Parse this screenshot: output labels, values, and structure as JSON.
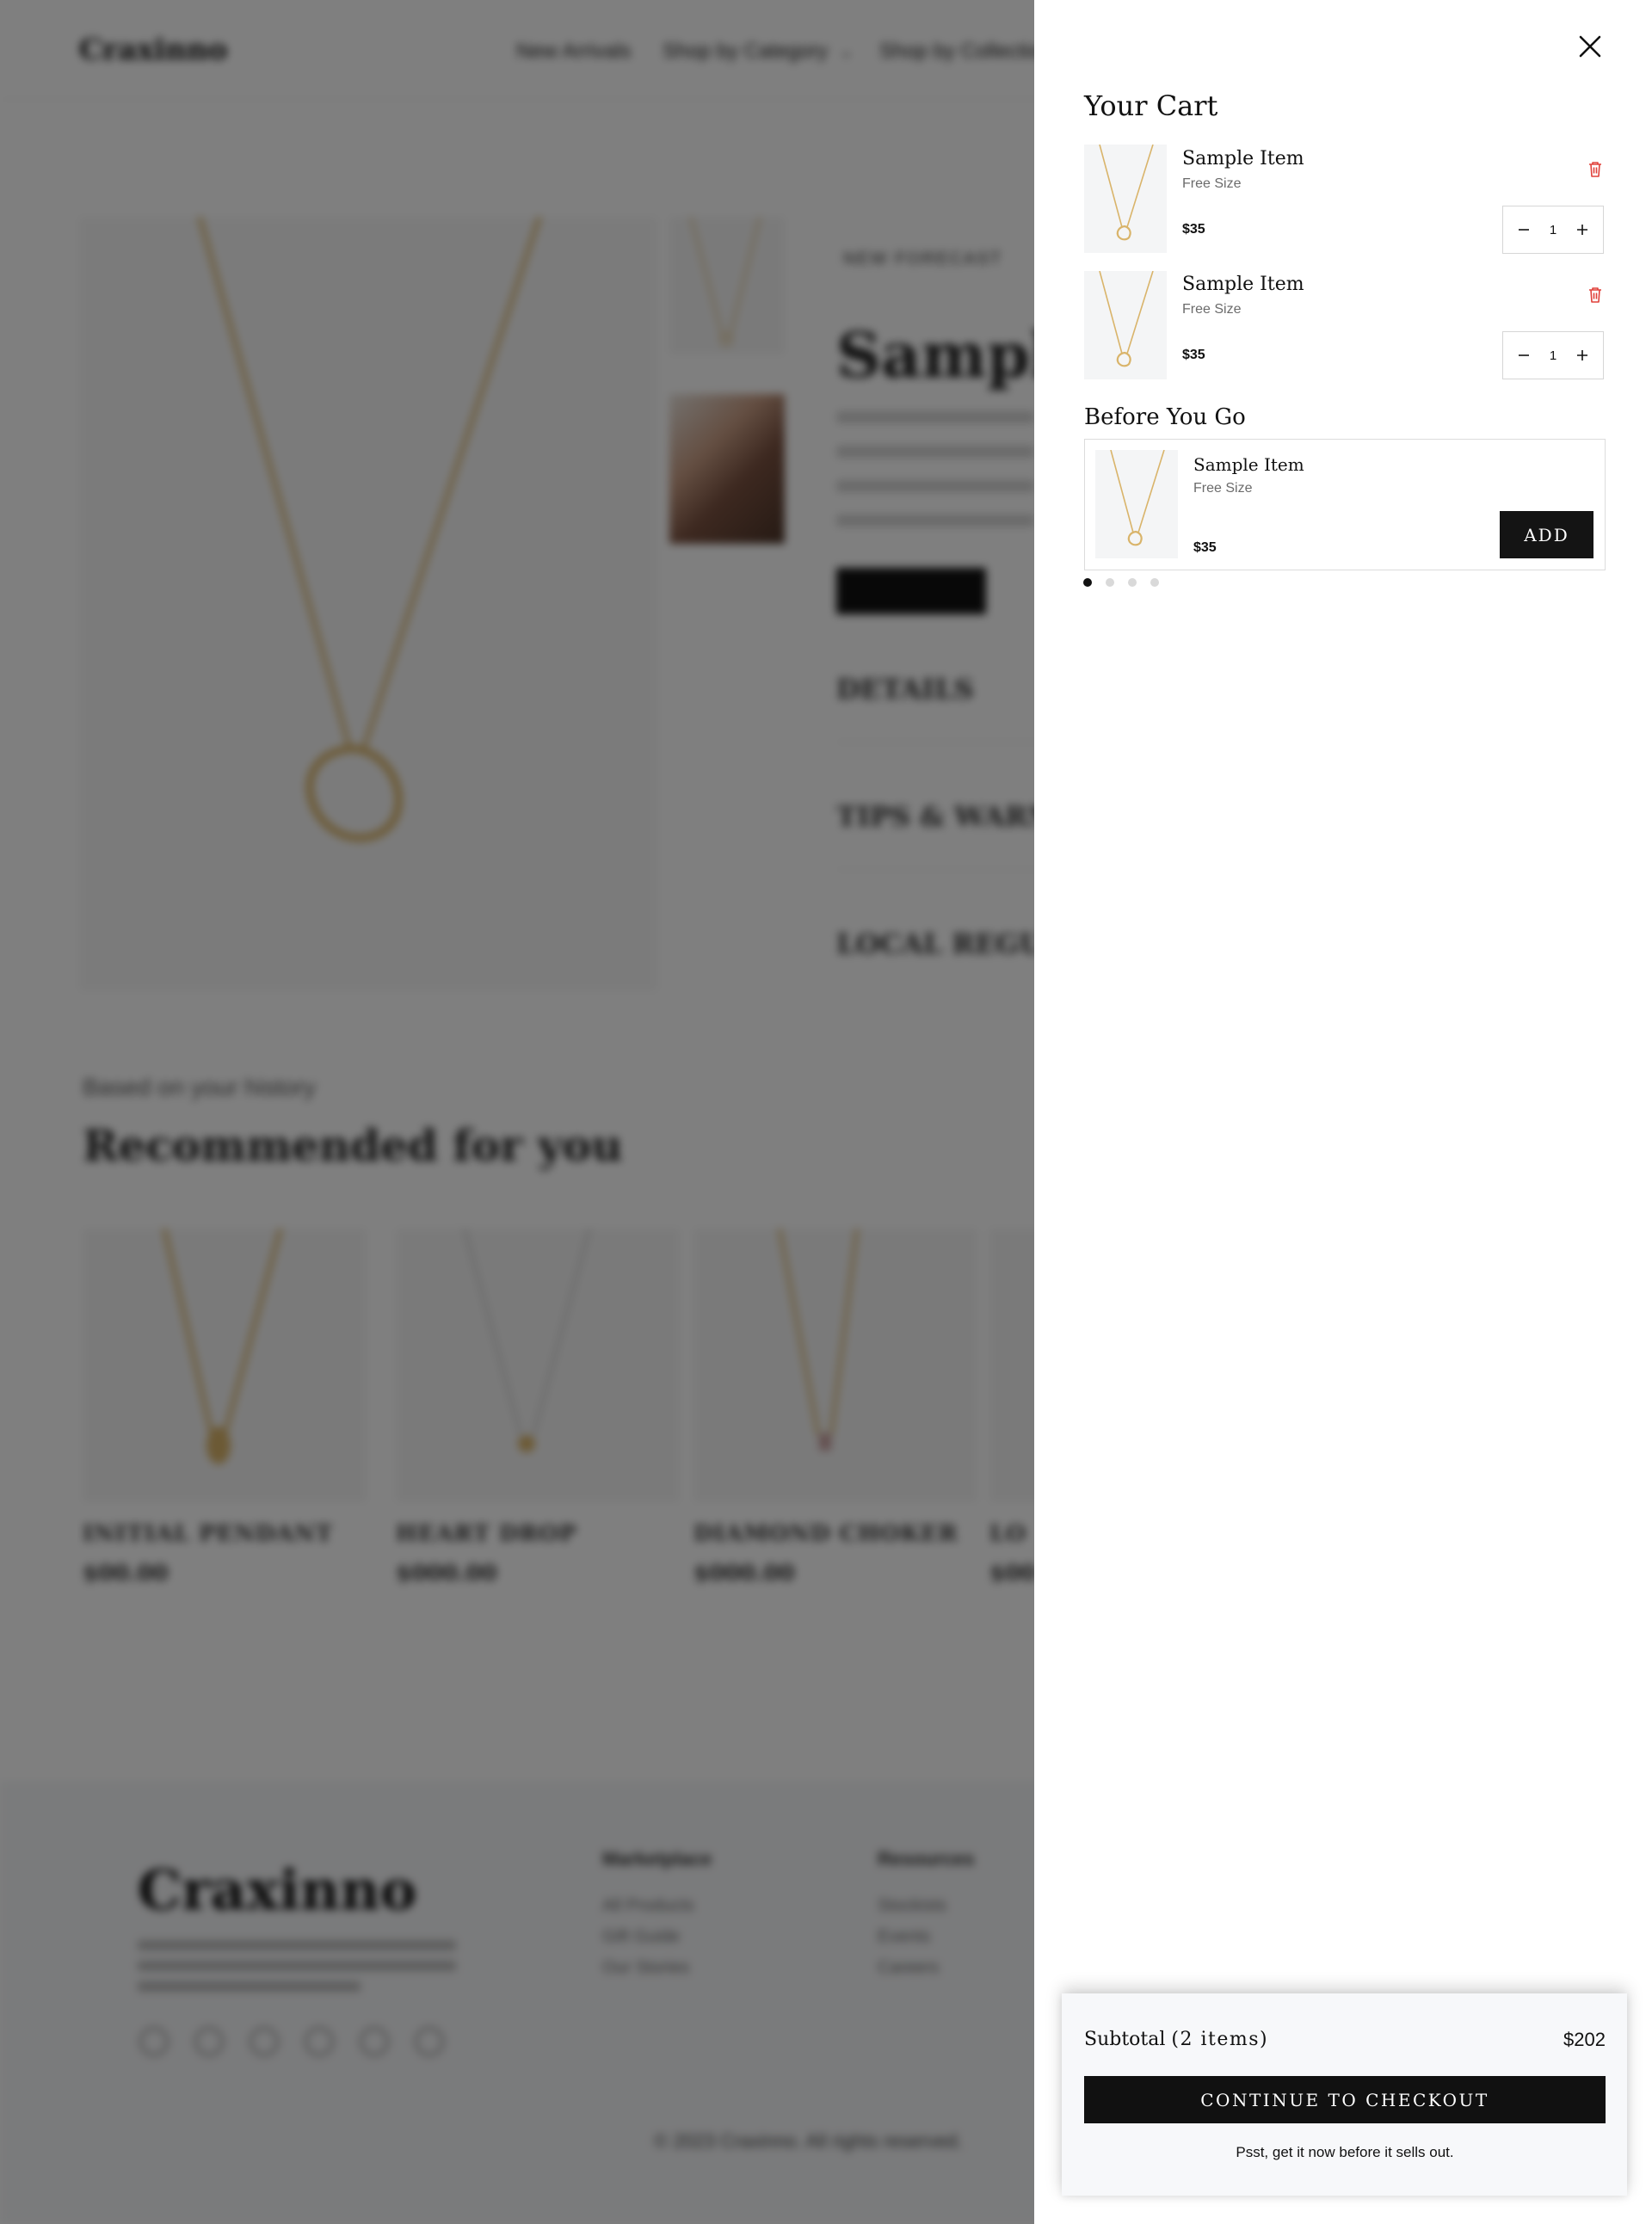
{
  "background": {
    "logo": "Craxinno",
    "nav": [
      "New Arrivals",
      "Shop by Category",
      "Shop by Collection"
    ],
    "eyebrow": "NEW FORECAST",
    "product_title": "Sample I",
    "accordions": [
      "DETAILS",
      "TIPS & WARNIN",
      "LOCAL REGULA"
    ],
    "recommended_sub": "Based on your history",
    "recommended_title": "Recommended for you",
    "cards": [
      {
        "name": "INITIAL PENDANT",
        "price": "$00.00"
      },
      {
        "name": "HEART DROP",
        "price": "$000.00"
      },
      {
        "name": "DIAMOND CHOKER",
        "price": "$000.00"
      },
      {
        "name": "LO",
        "price": "$00"
      }
    ],
    "footer": {
      "logo": "Craxinno",
      "col1_title": "Marketplace",
      "col1_items": [
        "All Products",
        "Gift Guide",
        "Our Stories"
      ],
      "col2_title": "Resources",
      "col2_items": [
        "Stockists",
        "Events",
        "Careers"
      ],
      "copyright": "© 2023 Craxinno. All rights reserved."
    }
  },
  "cart": {
    "title": "Your Cart",
    "close_icon": "close-icon",
    "items": [
      {
        "name": "Sample Item",
        "size": "Free Size",
        "price": "$35",
        "qty": "1"
      },
      {
        "name": "Sample Item",
        "size": "Free Size",
        "price": "$35",
        "qty": "1"
      }
    ],
    "before_you_go": {
      "title": "Before You Go",
      "item": {
        "name": "Sample Item",
        "size": "Free Size",
        "price": "$35"
      },
      "add_label": "ADD",
      "dots": 4
    },
    "subtotal_label": "Subtotal",
    "subtotal_count": "(2 items)",
    "subtotal_value": "$202",
    "checkout_label": "CONTINUE TO CHECKOUT",
    "psst": "Psst, get it now before it sells out."
  },
  "colors": {
    "accent": "#111111",
    "delete": "#e0403a",
    "overlay": "rgba(0,0,0,0.5)",
    "pendant_gold": "#d9b46a"
  }
}
